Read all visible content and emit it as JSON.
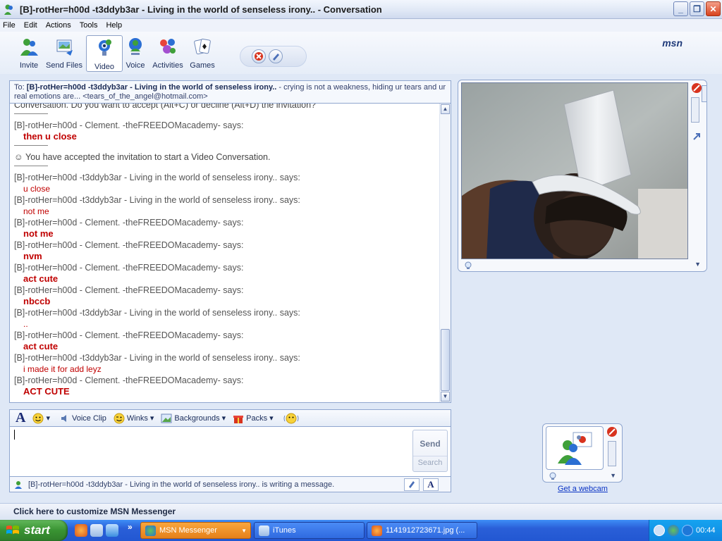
{
  "window": {
    "title": "[B]-rotHer=h00d -t3ddyb3ar -  Living in the world of senseless irony.. - Conversation",
    "controls": [
      "_",
      "❐",
      "✕"
    ]
  },
  "menu": [
    "File",
    "Edit",
    "Actions",
    "Tools",
    "Help"
  ],
  "toolbar": {
    "items": [
      {
        "label": "Invite",
        "icon": "invite-icon"
      },
      {
        "label": "Send Files",
        "icon": "send-files-icon"
      },
      {
        "label": "Video",
        "icon": "video-icon",
        "active": true
      },
      {
        "label": "Voice",
        "icon": "voice-icon"
      },
      {
        "label": "Activities",
        "icon": "activities-icon"
      },
      {
        "label": "Games",
        "icon": "games-icon"
      }
    ],
    "logo": "msn"
  },
  "to": {
    "prefix": "To:",
    "name": "[B]-rotHer=h00d -t3ddyb3ar -  Living in the world of senseless irony..",
    "status": " - crying is not a weakness, hiding ur tears and ur real emotions are...",
    "email": "<tears_of_the_angel@hotmail.com>"
  },
  "history": {
    "top_partial": "Conversation. Do you want to accept (Alt+C) or decline (Alt+D) the invitation?",
    "entries": [
      {
        "sender": "[B]-rotHer=h00d - Clement.     -theFREEDOMacademy- says:",
        "message": "then u close",
        "style": "bold"
      },
      {
        "system": "You have accepted the invitation to start a Video Conversation."
      },
      {
        "sender": "[B]-rotHer=h00d -t3ddyb3ar -  Living in the world of senseless irony.. says:",
        "message": "u close",
        "style": "normal"
      },
      {
        "sender": "[B]-rotHer=h00d -t3ddyb3ar -  Living in the world of senseless irony.. says:",
        "message": "not me",
        "style": "normal"
      },
      {
        "sender": "[B]-rotHer=h00d - Clement.     -theFREEDOMacademy- says:",
        "message": "not me",
        "style": "bold"
      },
      {
        "sender": "[B]-rotHer=h00d - Clement.     -theFREEDOMacademy- says:",
        "message": "nvm",
        "style": "bold"
      },
      {
        "sender": "[B]-rotHer=h00d - Clement.     -theFREEDOMacademy- says:",
        "message": "act cute",
        "style": "bold"
      },
      {
        "sender": "[B]-rotHer=h00d - Clement.     -theFREEDOMacademy- says:",
        "message": "nbccb",
        "style": "bold"
      },
      {
        "sender": "[B]-rotHer=h00d -t3ddyb3ar -  Living in the world of senseless irony.. says:",
        "message": "..",
        "style": "normal"
      },
      {
        "sender": "[B]-rotHer=h00d - Clement.     -theFREEDOMacademy- says:",
        "message": "act cute",
        "style": "bold"
      },
      {
        "sender": "[B]-rotHer=h00d -t3ddyb3ar -  Living in the world of senseless irony.. says:",
        "message": "i made it for add leyz",
        "style": "normal"
      },
      {
        "sender": "[B]-rotHer=h00d - Clement.     -theFREEDOMacademy- says:",
        "message": "ACT CUTE",
        "style": "bold"
      }
    ]
  },
  "format_bar": {
    "voice_clip": "Voice Clip",
    "winks": "Winks",
    "backgrounds": "Backgrounds",
    "packs": "Packs"
  },
  "compose": {
    "send": "Send",
    "search": "Search"
  },
  "typing_status": "[B]-rotHer=h00d -t3ddyb3ar -  Living in the world of senseless irony.. is writing a message.",
  "get_webcam": "Get a webcam",
  "customize": "Click here to customize MSN Messenger",
  "taskbar": {
    "start": "start",
    "tasks": [
      {
        "label": "MSN Messenger",
        "active": true
      },
      {
        "label": "iTunes",
        "active": false
      },
      {
        "label": "1141912723671.jpg (...",
        "active": false
      }
    ],
    "clock": "00:44"
  },
  "colors": {
    "message_red": "#c00000",
    "accent_blue": "#8fa6cf",
    "taskbar_blue": "#2a5fd8",
    "start_green": "#399332"
  }
}
